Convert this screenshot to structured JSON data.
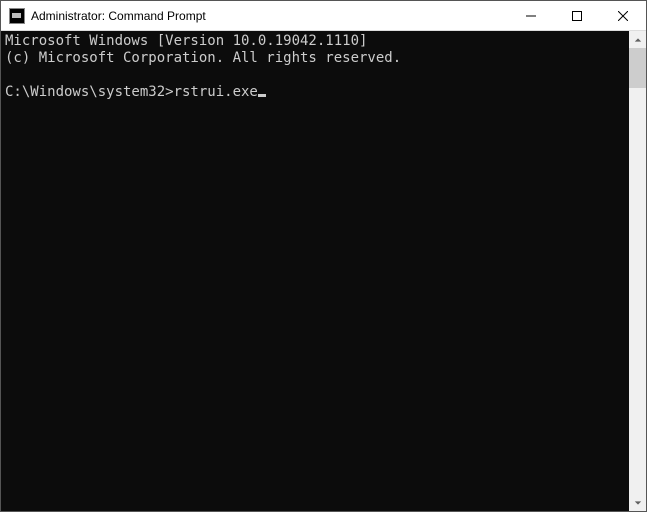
{
  "window": {
    "title": "Administrator: Command Prompt"
  },
  "terminal": {
    "line1": "Microsoft Windows [Version 10.0.19042.1110]",
    "line2": "(c) Microsoft Corporation. All rights reserved.",
    "blank": "",
    "prompt": "C:\\Windows\\system32>",
    "command": "rstrui.exe"
  }
}
